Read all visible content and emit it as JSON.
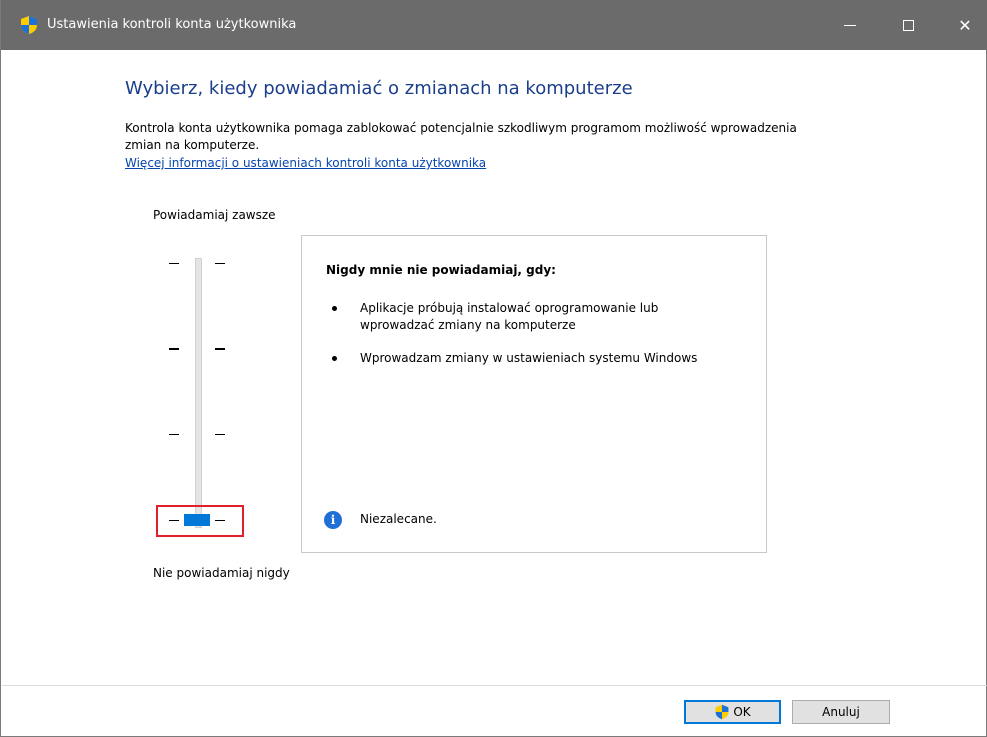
{
  "window": {
    "title": "Ustawienia kontroli konta użytkownika",
    "icon": "uac-shield-icon"
  },
  "content": {
    "heading": "Wybierz, kiedy powiadamiać o zmianach na komputerze",
    "description": "Kontrola konta użytkownika pomaga zablokować potencjalnie szkodliwym programom możliwość wprowadzenia zmian na komputerze.",
    "link": "Więcej informacji o ustawieniach kontroli konta użytkownika"
  },
  "slider": {
    "top_label": "Powiadamiaj zawsze",
    "bottom_label": "Nie powiadamiaj nigdy",
    "levels": 4,
    "selected_level": 0,
    "accent": "#0078d7"
  },
  "panel": {
    "title": "Nigdy mnie nie powiadamiaj, gdy:",
    "bullets": [
      "Aplikacje próbują instalować oprogramowanie lub wprowadzać zmiany na komputerze",
      "Wprowadzam zmiany w ustawieniach systemu Windows"
    ],
    "info_icon": "info-icon",
    "info_text": "Niezalecane."
  },
  "buttons": {
    "ok": "OK",
    "cancel": "Anuluj"
  }
}
